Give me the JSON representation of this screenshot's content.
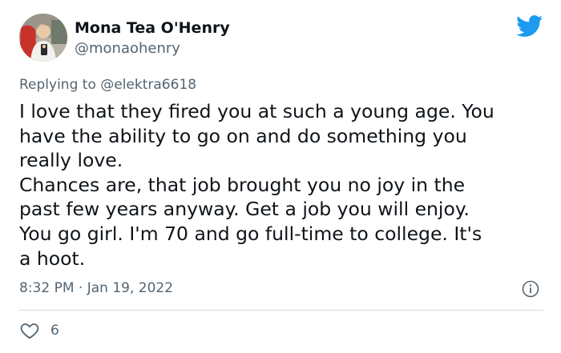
{
  "author": {
    "display_name": "Mona Tea O'Henry",
    "handle": "@monaohenry"
  },
  "icons": {
    "platform": "twitter-bird-icon",
    "info": "info-icon",
    "like": "heart-icon"
  },
  "colors": {
    "brand": "#1d9bf0",
    "text_primary": "#0f1419",
    "text_secondary": "#536471",
    "divider": "#cfd9de"
  },
  "reply": {
    "prefix": "Replying to",
    "mention": "@elektra6618"
  },
  "tweet": {
    "lines": [
      "I love that they fired you at such a young age.  You",
      "have the ability to go on and do something you",
      "really love.",
      "Chances are, that job brought you no joy in the",
      "past few years anyway.  Get a job you will enjoy.",
      "You go girl. I'm 70 and go full-time to college.  It's",
      "a hoot."
    ]
  },
  "meta": {
    "timestamp": "8:32 PM · Jan 19, 2022"
  },
  "engagement": {
    "likes": "6"
  }
}
